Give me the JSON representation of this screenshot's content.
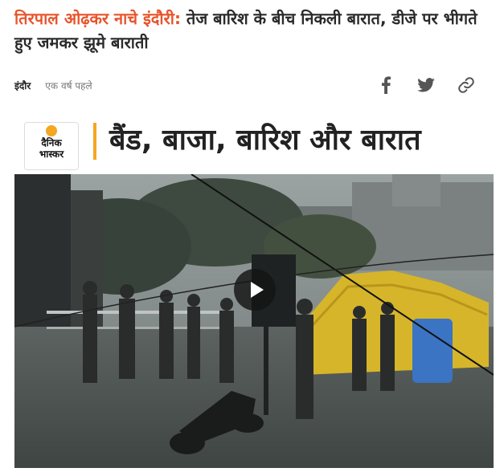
{
  "article": {
    "kicker": "तिरपाल ओढ़कर नाचे इंदौरी:",
    "headline": " तेज बारिश के बीच निकली बारात, डीजे पर भीगते हुए जमकर झूमे बाराती",
    "location": "इंदौर",
    "time_ago": "एक वर्ष पहले"
  },
  "share": {
    "icons": [
      "facebook-icon",
      "twitter-icon",
      "link-icon"
    ]
  },
  "video": {
    "logo_line1": "दैनिक",
    "logo_line2": "भास्कर",
    "banner_title": "बैंड, बाजा, बारिश और बारात",
    "play_icon": "play-icon"
  },
  "colors": {
    "kicker": "#e8542b",
    "accent": "#f5a623",
    "headline": "#2a2a2a"
  }
}
